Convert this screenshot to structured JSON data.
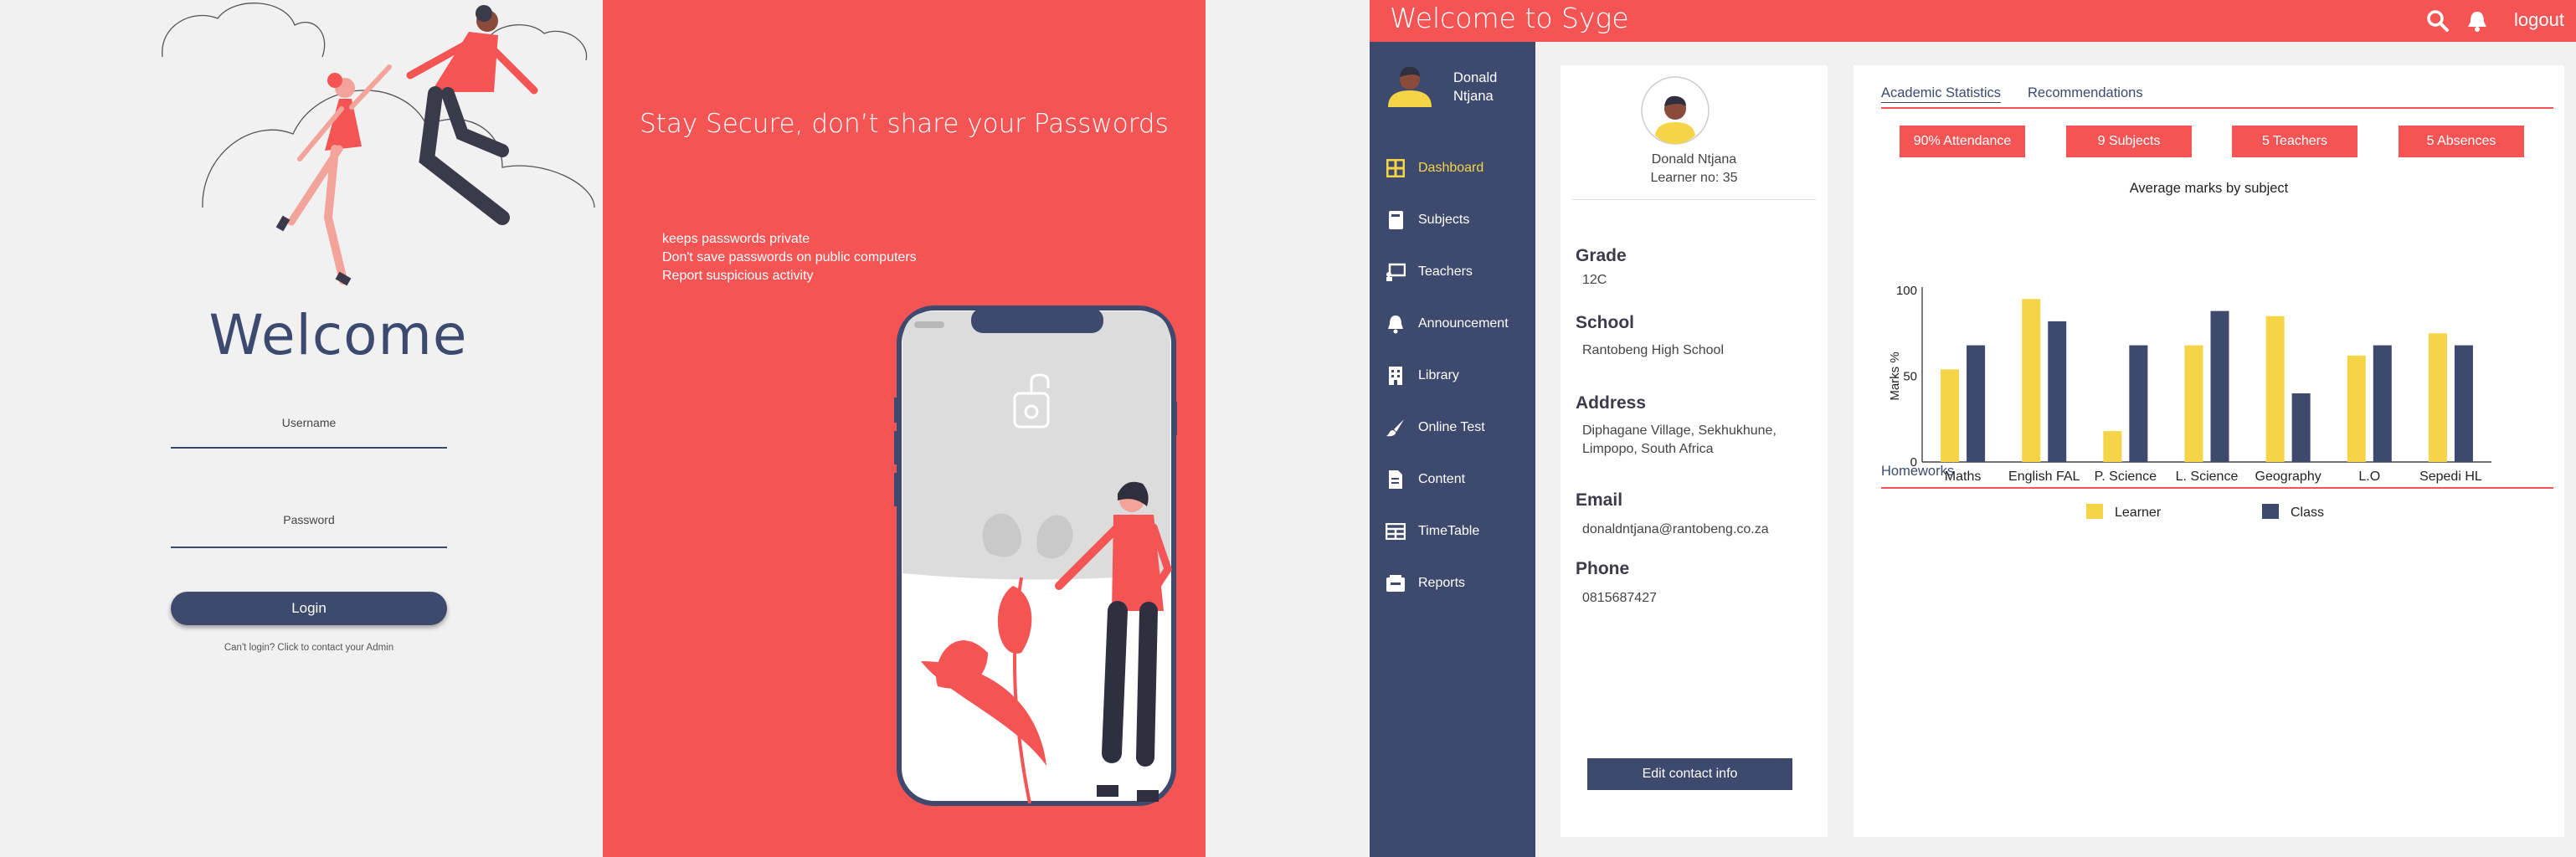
{
  "login": {
    "welcome": "Welcome",
    "username_label": "Username",
    "password_label": "Password",
    "login_button": "Login",
    "cant_login": "Can't login? Click to contact your Admin"
  },
  "secure": {
    "heading": "Stay Secure, don’t share your Passwords",
    "tips": [
      "keeps passwords private",
      "Don't save passwords on public computers",
      "Report suspicious activity"
    ]
  },
  "app": {
    "title": "Welcome to Syge",
    "logout": "logout",
    "icons": {
      "search": "search-icon",
      "bell": "bell-icon"
    }
  },
  "sidebar": {
    "user_name": "Donald Ntjana",
    "items": [
      {
        "label": "Dashboard",
        "icon": "grid-icon",
        "active": true
      },
      {
        "label": "Subjects",
        "icon": "book-icon",
        "active": false
      },
      {
        "label": "Teachers",
        "icon": "presentation-icon",
        "active": false
      },
      {
        "label": "Announcement",
        "icon": "bell-icon",
        "active": false
      },
      {
        "label": "Library",
        "icon": "building-icon",
        "active": false
      },
      {
        "label": "Online Test",
        "icon": "brush-icon",
        "active": false
      },
      {
        "label": "Content",
        "icon": "document-icon",
        "active": false
      },
      {
        "label": "TimeTable",
        "icon": "table-icon",
        "active": false
      },
      {
        "label": "Reports",
        "icon": "inbox-icon",
        "active": false
      }
    ]
  },
  "profile": {
    "name": "Donald Ntjana",
    "learner_no": "Learner no: 35",
    "grade_label": "Grade",
    "grade": "12C",
    "school_label": "School",
    "school": "Rantobeng High School",
    "address_label": "Address",
    "address_line1": "Diphagane Village,  Sekhukhune,",
    "address_line2": "Limpopo, South Africa",
    "email_label": "Email",
    "email": "donaldntjana@rantobeng.co.za",
    "phone_label": "Phone",
    "phone": "0815687427",
    "edit_button": "Edit contact info"
  },
  "stats": {
    "tabs": [
      "Academic Statistics",
      "Recommendations"
    ],
    "badges": [
      "90% Attendance",
      "9 Subjects",
      "5 Teachers",
      "5 Absences"
    ],
    "homeworks": "Homeworks"
  },
  "colors": {
    "accent": "#f45454",
    "navy": "#3d4a6e",
    "yellow": "#f5d547",
    "skin": "#f2a39a"
  },
  "chart_data": {
    "type": "bar",
    "title": "Average marks by subject",
    "ylabel": "Marks %",
    "xlabel": "",
    "ylim": [
      0,
      100
    ],
    "yticks": [
      0,
      50,
      100
    ],
    "categories": [
      "Maths",
      "English FAL",
      "P. Science",
      "L. Science",
      "Geography",
      "L.O",
      "Sepedi HL"
    ],
    "series": [
      {
        "name": "Learner",
        "color": "#f5d547",
        "values": [
          54,
          95,
          18,
          68,
          85,
          62,
          75
        ]
      },
      {
        "name": "Class",
        "color": "#3d4a6e",
        "values": [
          68,
          82,
          68,
          88,
          40,
          68,
          68
        ]
      }
    ],
    "legend": "bottom"
  }
}
